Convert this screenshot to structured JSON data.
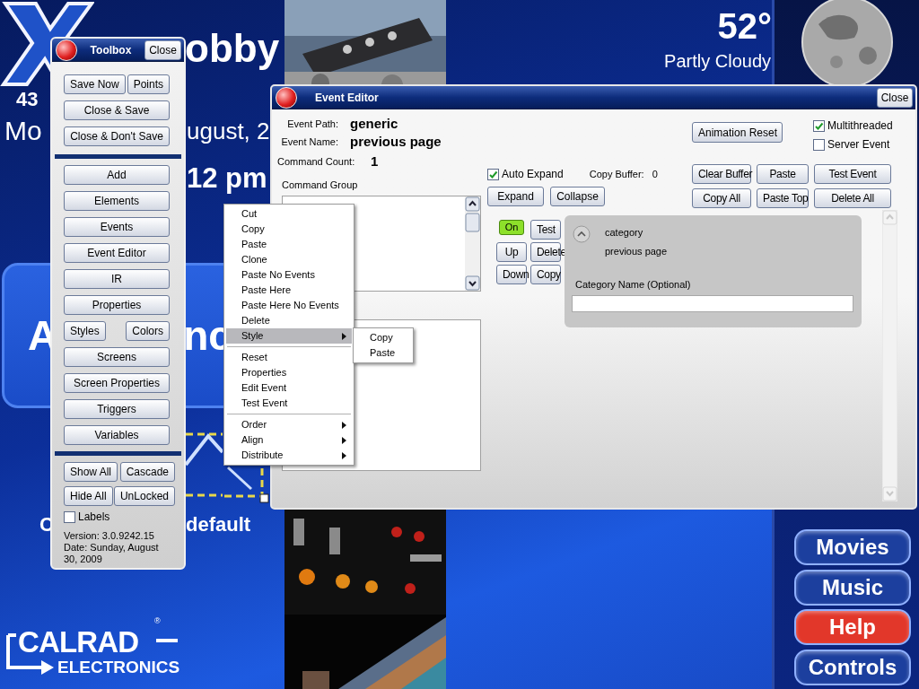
{
  "screen": {
    "title": "obby",
    "temperature": "43",
    "date_fragments": [
      "Mo",
      "ugust, 2"
    ],
    "time": "12 pm",
    "tile_button": [
      "A",
      "nc"
    ],
    "caption_fragments": [
      "C",
      "default"
    ],
    "weather": {
      "temperature": "52°",
      "condition": "Partly Cloudy"
    },
    "nav_buttons": [
      {
        "label": "Movies",
        "color": "#1c3f9e"
      },
      {
        "label": "Music",
        "color": "#1c3f9e"
      },
      {
        "label": "Help",
        "color": "#e2372a"
      },
      {
        "label": "Controls",
        "color": "#1c3f9e"
      }
    ],
    "logo": {
      "name": "CALRAD",
      "mark": "®",
      "subtitle": "ELECTRONICS"
    }
  },
  "toolbox": {
    "title": "Toolbox",
    "close": "Close",
    "groups": [
      [
        [
          "Save Now",
          "Points"
        ],
        [
          "Close & Save"
        ],
        [
          "Close & Don't Save"
        ]
      ],
      [
        [
          "Add"
        ],
        [
          "Elements"
        ],
        [
          "Events"
        ],
        [
          "Event Editor"
        ],
        [
          "IR"
        ],
        [
          "Properties"
        ],
        [
          "Styles",
          "Colors"
        ],
        [
          "Screens"
        ],
        [
          "Screen Properties"
        ],
        [
          "Triggers"
        ],
        [
          "Variables"
        ]
      ],
      [
        [
          "Show All",
          "Cascade"
        ],
        [
          "Hide All",
          "UnLocked"
        ]
      ]
    ],
    "labels": {
      "label": "Labels",
      "checked": false
    },
    "version": "Version: 3.0.9242.15",
    "date": "Date: Sunday, August 30, 2009"
  },
  "event_editor": {
    "title": "Event Editor",
    "close": "Close",
    "fields": [
      {
        "label": "Event Path:",
        "value": "generic"
      },
      {
        "label": "Event Name:",
        "value": "previous page"
      },
      {
        "label": "Command Count:",
        "value": "1"
      }
    ],
    "command_group_label": "Command Group",
    "animation_reset": "Animation Reset",
    "options": [
      {
        "label": "Multithreaded",
        "checked": true
      },
      {
        "label": "Server Event",
        "checked": false
      }
    ],
    "auto_expand": {
      "label": "Auto Expand",
      "checked": true
    },
    "copy_buffer": {
      "label": "Copy Buffer:",
      "value": "0"
    },
    "expand_buttons": [
      "Expand",
      "Collapse"
    ],
    "buffer_buttons": [
      "Clear Buffer",
      "Paste",
      "Test Event",
      "Copy All",
      "Paste Top",
      "Delete All"
    ],
    "command": {
      "toggle": {
        "label": "On",
        "on": true
      },
      "buttons": [
        "Test",
        "Up",
        "Delete",
        "Down",
        "Copy"
      ],
      "expanded": true,
      "type": "category",
      "name": "previous page",
      "field_label": "Category Name (Optional)"
    }
  },
  "context_menu": {
    "groups": [
      [
        {
          "label": "Cut",
          "selected": false,
          "submenu": false
        },
        {
          "label": "Copy",
          "selected": false,
          "submenu": false
        },
        {
          "label": "Paste",
          "selected": false,
          "submenu": false
        },
        {
          "label": "Clone",
          "selected": false,
          "submenu": false
        },
        {
          "label": "Paste No Events",
          "selected": false,
          "submenu": false
        },
        {
          "label": "Paste Here",
          "selected": false,
          "submenu": false
        },
        {
          "label": "Paste Here No Events",
          "selected": false,
          "submenu": false
        },
        {
          "label": "Delete",
          "selected": false,
          "submenu": false
        },
        {
          "label": "Style",
          "selected": true,
          "submenu": true
        }
      ],
      [
        {
          "label": "Reset",
          "selected": false,
          "submenu": false
        },
        {
          "label": "Properties",
          "selected": false,
          "submenu": false
        },
        {
          "label": "Edit Event",
          "selected": false,
          "submenu": false
        },
        {
          "label": "Test Event",
          "selected": false,
          "submenu": false
        }
      ],
      [
        {
          "label": "Order",
          "selected": false,
          "submenu": true
        },
        {
          "label": "Align",
          "selected": false,
          "submenu": true
        },
        {
          "label": "Distribute",
          "selected": false,
          "submenu": true
        }
      ]
    ],
    "submenu": [
      "Copy",
      "Paste"
    ]
  }
}
